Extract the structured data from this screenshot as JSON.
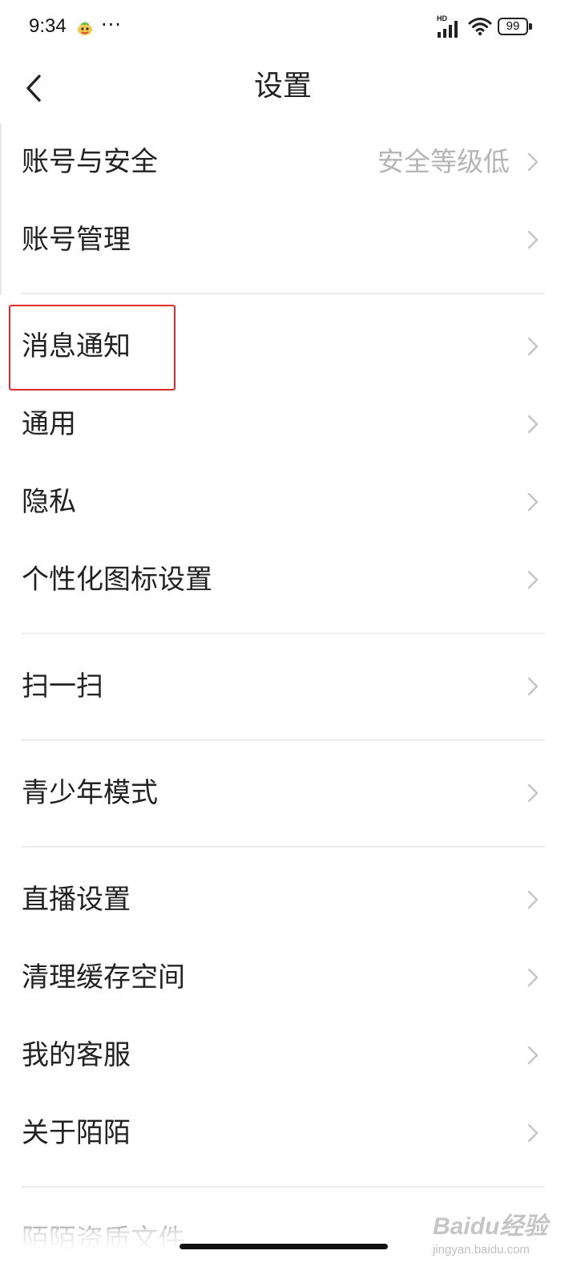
{
  "status_bar": {
    "time": "9:34",
    "more": "···",
    "network": "HD",
    "battery": "99"
  },
  "header": {
    "title": "设置"
  },
  "groups": [
    {
      "items": [
        {
          "label": "账号与安全",
          "value": "安全等级低"
        },
        {
          "label": "账号管理"
        }
      ]
    },
    {
      "items": [
        {
          "label": "消息通知"
        },
        {
          "label": "通用"
        },
        {
          "label": "隐私"
        },
        {
          "label": "个性化图标设置"
        }
      ]
    },
    {
      "items": [
        {
          "label": "扫一扫"
        }
      ]
    },
    {
      "items": [
        {
          "label": "青少年模式"
        }
      ]
    },
    {
      "items": [
        {
          "label": "直播设置"
        },
        {
          "label": "清理缓存空间"
        },
        {
          "label": "我的客服"
        },
        {
          "label": "关于陌陌"
        }
      ]
    },
    {
      "items": [
        {
          "label": "陌陌资质文件"
        }
      ]
    }
  ],
  "watermark": {
    "text": "Baidu经验",
    "sub": "jingyan.baidu.com"
  },
  "colors": {
    "highlight": "#e02b2b",
    "secondary_text": "#b5b5b5",
    "divider": "#ececec"
  }
}
